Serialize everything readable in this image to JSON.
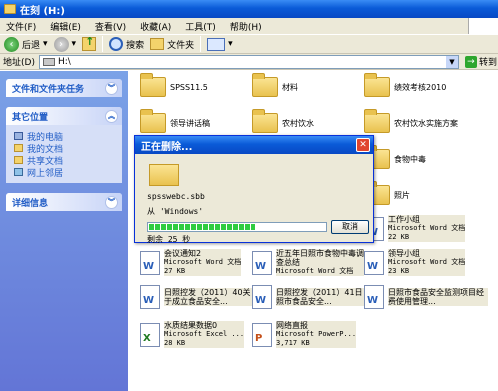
{
  "window": {
    "title": "在刻 (H:)"
  },
  "menu": {
    "items": [
      "文件(F)",
      "编辑(E)",
      "查看(V)",
      "收藏(A)",
      "工具(T)",
      "帮助(H)"
    ]
  },
  "toolbar": {
    "back": "后退",
    "search": "搜索",
    "folders": "文件夹"
  },
  "address": {
    "label": "地址(D)",
    "value": "H:\\",
    "go": "转到"
  },
  "tasks": {
    "file_tasks": "文件和文件夹任务",
    "other_places": "其它位置",
    "places": [
      "我的电脑",
      "我的文档",
      "共享文档",
      "网上邻居"
    ],
    "details": "详细信息"
  },
  "folders": [
    {
      "name": "SPSS11.5"
    },
    {
      "name": "材料"
    },
    {
      "name": "绩效考核2010"
    },
    {
      "name": "领导讲话稿"
    },
    {
      "name": "农村饮水"
    },
    {
      "name": "农村饮水实施方案"
    },
    {
      "name": "食物中毒"
    },
    {
      "name": "照片"
    }
  ],
  "files": [
    {
      "name": "工作小组",
      "type": "Microsoft Word 文档",
      "size": "22 KB",
      "kind": "doc"
    },
    {
      "name": "会议通知2",
      "type": "Microsoft Word 文档",
      "size": "27 KB",
      "kind": "doc"
    },
    {
      "name": "近五年日照市食物中毒调查总结",
      "type": "Microsoft Word 文档",
      "size": "",
      "kind": "doc"
    },
    {
      "name": "领导小组",
      "type": "Microsoft Word 文档",
      "size": "23 KB",
      "kind": "doc"
    },
    {
      "name": "日照控发（2011）40关于成立食品安全...",
      "type": "",
      "size": "",
      "kind": "doc"
    },
    {
      "name": "日照控发（2011）41日照市食品安全...",
      "type": "",
      "size": "",
      "kind": "doc"
    },
    {
      "name": "日照市食品安全监测项目经费使用管理...",
      "type": "",
      "size": "",
      "kind": "doc"
    },
    {
      "name": "水质结果数据0",
      "type": "Microsoft Excel ...",
      "size": "28 KB",
      "kind": "xls"
    },
    {
      "name": "网络直报",
      "type": "Microsoft PowerP...",
      "size": "3,717 KB",
      "kind": "ppt"
    }
  ],
  "dialog": {
    "title": "正在删除...",
    "filename": "spsswebc.sbb",
    "from": "从 'Windows'",
    "remaining": "剩余 25 秒",
    "cancel": "取消",
    "progress_fraction": 0.6
  }
}
